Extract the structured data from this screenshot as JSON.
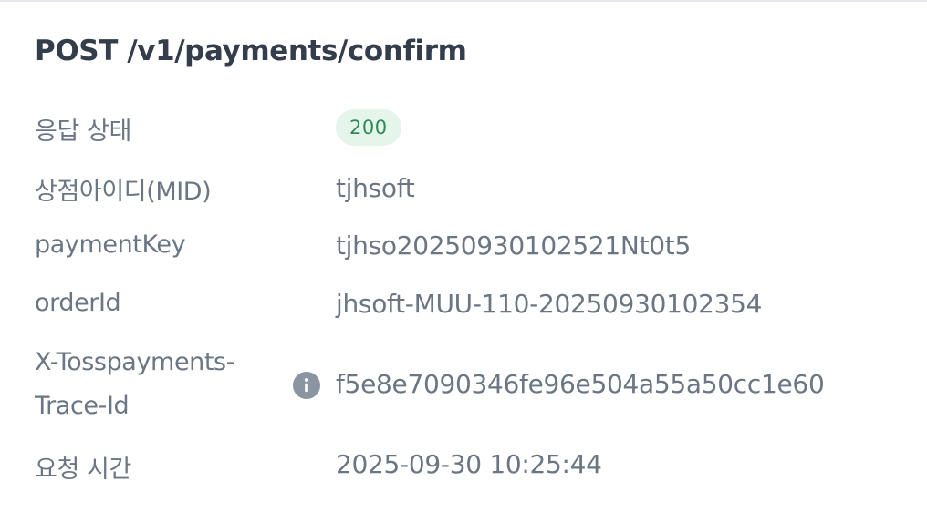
{
  "panel": {
    "title": "POST /v1/payments/confirm"
  },
  "rows": {
    "status": {
      "label": "응답 상태",
      "value": "200",
      "badge_color": "#2e8b57",
      "badge_bg": "#e5f5ea"
    },
    "mid": {
      "label": "상점아이디(MID)",
      "value": "tjhsoft"
    },
    "payment_key": {
      "label": "paymentKey",
      "value": "tjhso20250930102521Nt0t5"
    },
    "order_id": {
      "label": "orderId",
      "value": "jhsoft-MUU-110-20250930102354"
    },
    "trace_id": {
      "label_line1": "X-Tosspayments-",
      "label_line2": "Trace-Id",
      "value": "f5e8e7090346fe96e504a55a50cc1e60",
      "icon": "info-icon"
    },
    "request_time": {
      "label": "요청 시간",
      "value": "2025-09-30 10:25:44"
    }
  }
}
